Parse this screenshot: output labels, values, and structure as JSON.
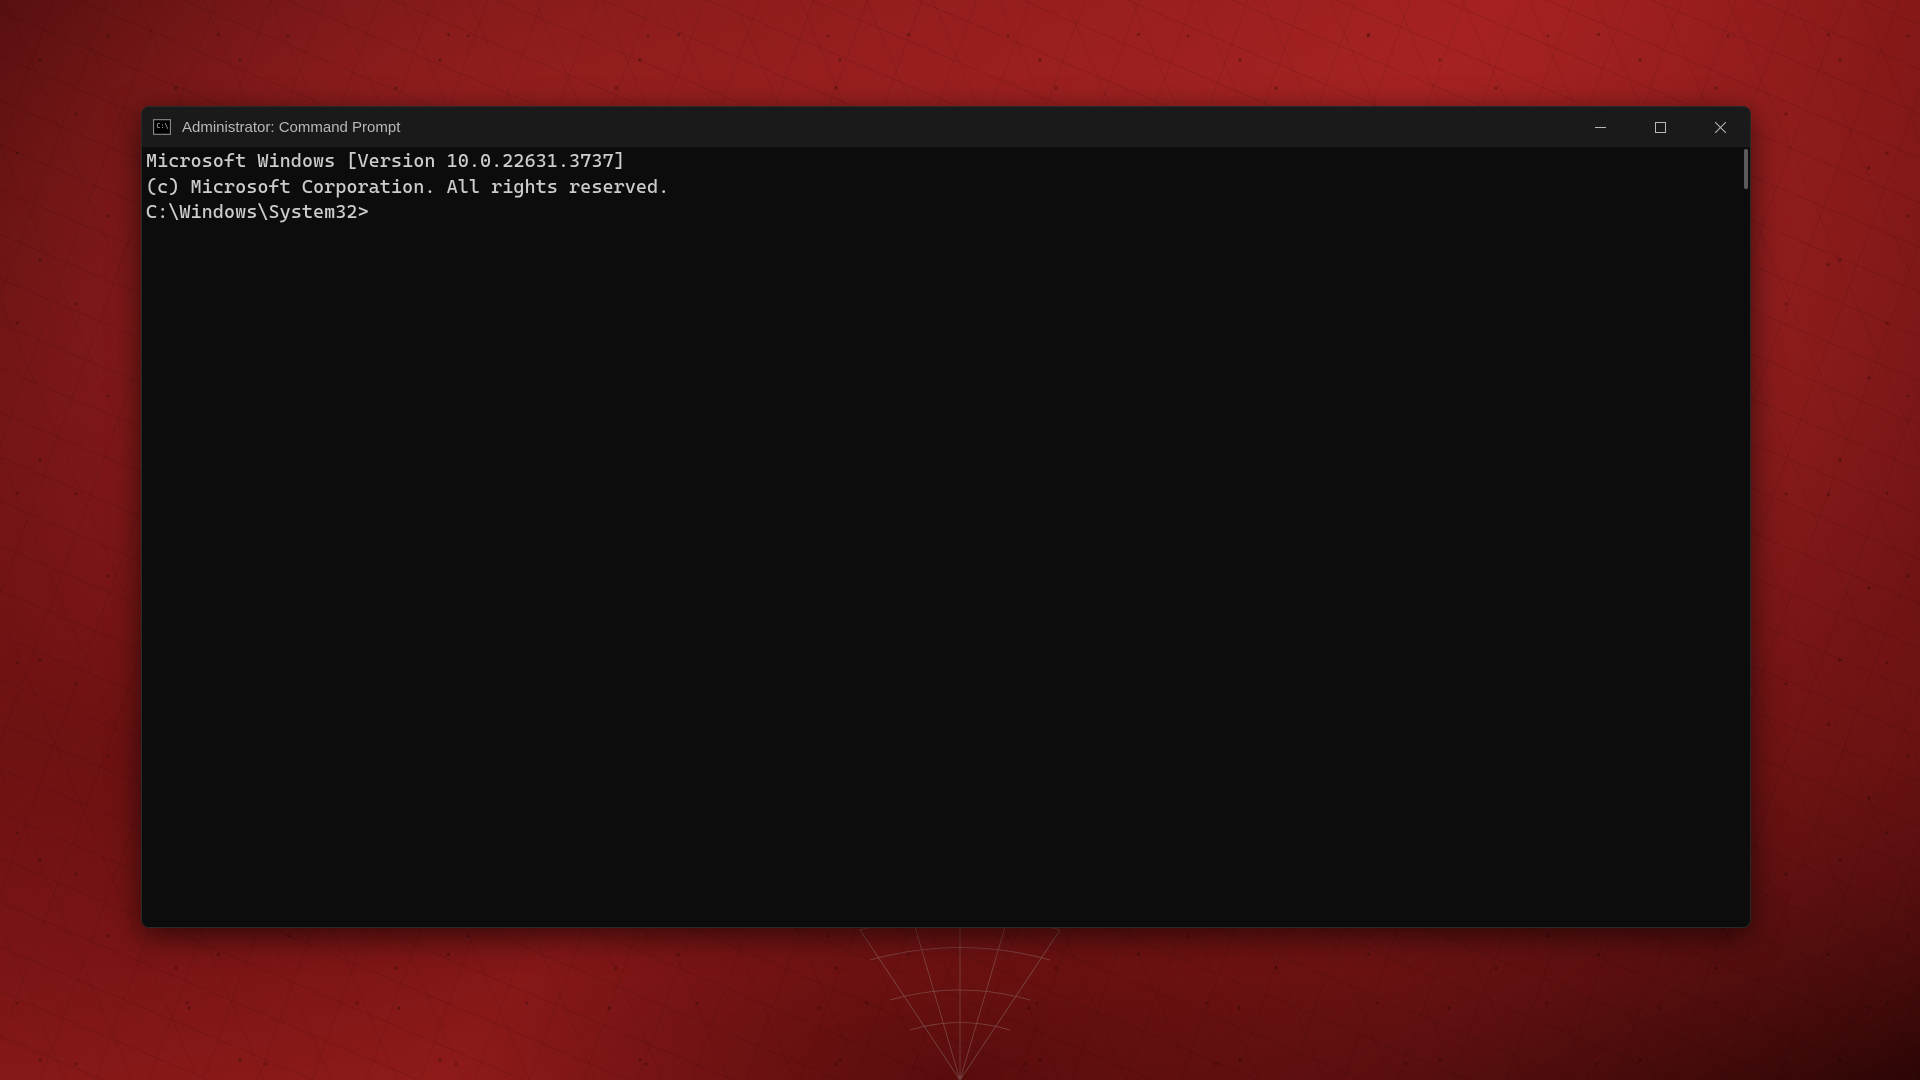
{
  "window": {
    "title": "Administrator: Command Prompt"
  },
  "terminal": {
    "line1": "Microsoft Windows [Version 10.0.22631.3737]",
    "line2": "(c) Microsoft Corporation. All rights reserved.",
    "blank": "",
    "prompt": "C:\\Windows\\System32>"
  }
}
